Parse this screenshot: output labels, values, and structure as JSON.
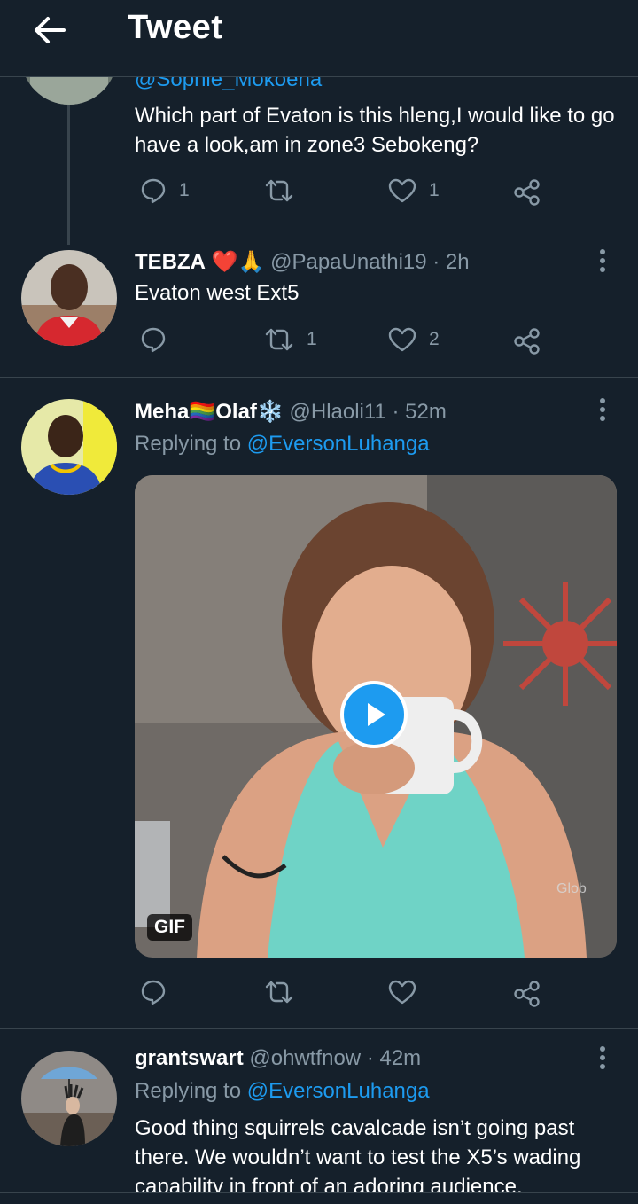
{
  "header": {
    "title": "Tweet",
    "back_icon": "arrow-left-icon"
  },
  "tweet1": {
    "handle_partial": "@Sophie_Mokoena",
    "text": "Which part of Evaton is this hleng,I would like to go have a look,am in zone3 Sebokeng?",
    "reply_count": "1",
    "retweet_count": "",
    "like_count": "1"
  },
  "tweet2": {
    "name": "TEBZA",
    "name_emojis": "❤️🙏",
    "handle": "@PapaUnathi19",
    "time": "· 2h",
    "text": "Evaton west Ext5",
    "reply_count": "",
    "retweet_count": "1",
    "like_count": "2"
  },
  "tweet3": {
    "name_part1": "Meha",
    "name_flag": "🏳️‍🌈",
    "name_part2": "Olaf",
    "name_snow": "❄️",
    "handle": "@Hlaoli11",
    "time": "· 52m",
    "replying_label": "Replying to",
    "replying_handle": "@EversonLuhanga",
    "gif_badge": "GIF",
    "media_watermark": "Glob",
    "reply_count": "",
    "retweet_count": "",
    "like_count": ""
  },
  "tweet4": {
    "name": "grantswart",
    "handle": "@ohwtfnow",
    "time": "· 42m",
    "replying_label": "Replying to",
    "replying_handle": "@EversonLuhanga",
    "text": "Good thing squirrels cavalcade isn’t going past there. We wouldn’t want to test the X5’s wading capability in front of an adoring  audience."
  },
  "colors": {
    "background": "#15202b",
    "divider": "#38444d",
    "muted": "#8899a6",
    "accent": "#1d9bf0",
    "heart": "#e0245e"
  }
}
